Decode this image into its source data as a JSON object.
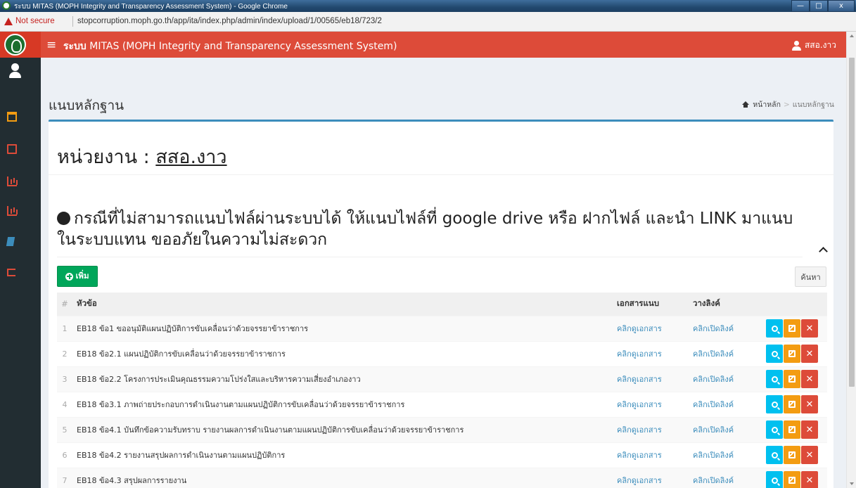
{
  "window": {
    "title": "ระบบ MITAS (MOPH Integrity and Transparency Assessment System) - Google Chrome",
    "minimize": "—",
    "maximize": "□",
    "close": "x"
  },
  "address": {
    "security_label": "Not secure",
    "url": "stopcorruption.moph.go.th/app/ita/index.php/admin/index/upload/1/00565/eb18/723/2"
  },
  "header": {
    "menu_icon": "≡",
    "title_bold": "ระบบ",
    "title_rest": " MITAS (MOPH Integrity and Transparency Assessment System)",
    "user_name": "สสอ.งาว"
  },
  "page": {
    "title": "แนบหลักฐาน",
    "breadcrumb_home": "หน้าหลัก",
    "breadcrumb_sep": ">",
    "breadcrumb_current": "แนบหลักฐาน"
  },
  "box": {
    "unit_label": "หน่วยงาน : ",
    "unit_name": "สสอ.งาว",
    "notice": "กรณีที่ไม่สามารถแนบไฟล์ผ่านระบบได้ ให้แนบไฟล์ที่ google drive หรือ ฝากไฟล์ และนำ LINK มาแนบในระบบแทน ขออภัยในความไม่สะดวก",
    "add_label": "เพิ่ม",
    "search_label": "ค้นหา"
  },
  "table": {
    "headers": {
      "num": "#",
      "title": "หัวข้อ",
      "doc": "เอกสารแนบ",
      "link": "วางลิงค์"
    },
    "rows": [
      {
        "num": "1",
        "title": "EB18 ข้อ1 ขออนุมัติแผนปฏิบัติการขับเคลื่อนว่าด้วยจรรยาข้าราชการ",
        "doc": "คลิกดูเอกสาร",
        "link": "คลิกเปิดลิงค์"
      },
      {
        "num": "2",
        "title": "EB18 ข้อ2.1 แผนปฏิบัติการขับเคลื่อนว่าด้วยจรรยาข้าราชการ",
        "doc": "คลิกดูเอกสาร",
        "link": "คลิกเปิดลิงค์"
      },
      {
        "num": "3",
        "title": "EB18 ข้อ2.2 โครงการประเมินคุณธรรมความโปร่งใสและบริหารความเสี่ยงอำเภองาว",
        "doc": "คลิกดูเอกสาร",
        "link": "คลิกเปิดลิงค์"
      },
      {
        "num": "4",
        "title": "EB18 ข้อ3.1 ภาพถ่ายประกอบการดำเนินงานตามแผนปฏิบัติการขับเคลื่อนว่าด้วยจรรยาข้าราชการ",
        "doc": "คลิกดูเอกสาร",
        "link": "คลิกเปิดลิงค์"
      },
      {
        "num": "5",
        "title": "EB18 ข้อ4.1 บันทึกข้อความรับทราบ รายงานผลการดำเนินงานตามแผนปฏิบัติการขับเคลื่อนว่าด้วยจรรยาข้าราชการ",
        "doc": "คลิกดูเอกสาร",
        "link": "คลิกเปิดลิงค์"
      },
      {
        "num": "6",
        "title": "EB18 ข้อ4.2 รายงานสรุปผลการดำเนินงานตามแผนปฏิบัติการ",
        "doc": "คลิกดูเอกสาร",
        "link": "คลิกเปิดลิงค์"
      },
      {
        "num": "7",
        "title": "EB18 ข้อ4.3 สรุปผลการรายงาน",
        "doc": "คลิกดูเอกสาร",
        "link": "คลิกเปิดลิงค์"
      }
    ]
  },
  "colors": {
    "header": "#dd4b39",
    "sidebar": "#222d32",
    "link": "#3c8dbc",
    "btn_view": "#00c0ef",
    "btn_edit": "#f39c12",
    "btn_delete": "#dd4b39",
    "btn_add": "#00a65a"
  },
  "icons": {
    "sidebar": [
      "user-icon",
      "calendar-icon",
      "file-icon",
      "bar-chart-icon",
      "bar-chart-icon",
      "book-icon",
      "sign-out-icon"
    ],
    "row_actions": [
      "search-icon",
      "edit-icon",
      "close-icon"
    ]
  }
}
